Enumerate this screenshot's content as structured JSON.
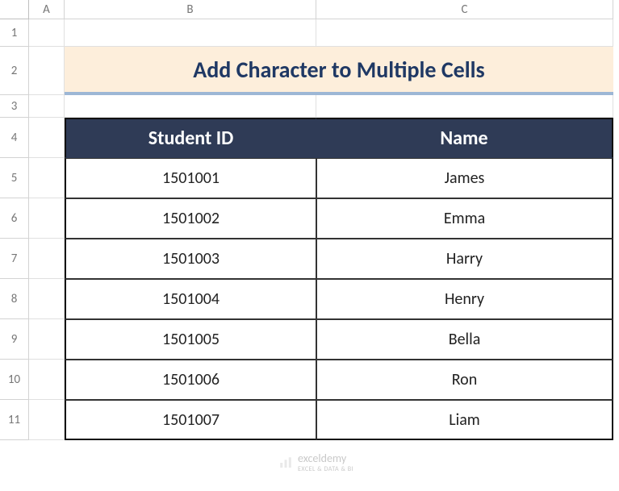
{
  "columns": [
    "A",
    "B",
    "C"
  ],
  "rows": [
    "1",
    "2",
    "3",
    "4",
    "5",
    "6",
    "7",
    "8",
    "9",
    "10",
    "11"
  ],
  "title": "Add Character to Multiple Cells",
  "table": {
    "headers": [
      "Student ID",
      "Name"
    ],
    "data": [
      {
        "id": "1501001",
        "name": "James"
      },
      {
        "id": "1501002",
        "name": "Emma"
      },
      {
        "id": "1501003",
        "name": "Harry"
      },
      {
        "id": "1501004",
        "name": "Henry"
      },
      {
        "id": "1501005",
        "name": "Bella"
      },
      {
        "id": "1501006",
        "name": "Ron"
      },
      {
        "id": "1501007",
        "name": "Liam"
      }
    ]
  },
  "watermark": {
    "brand": "exceldemy",
    "tagline": "EXCEL & DATA & BI"
  }
}
